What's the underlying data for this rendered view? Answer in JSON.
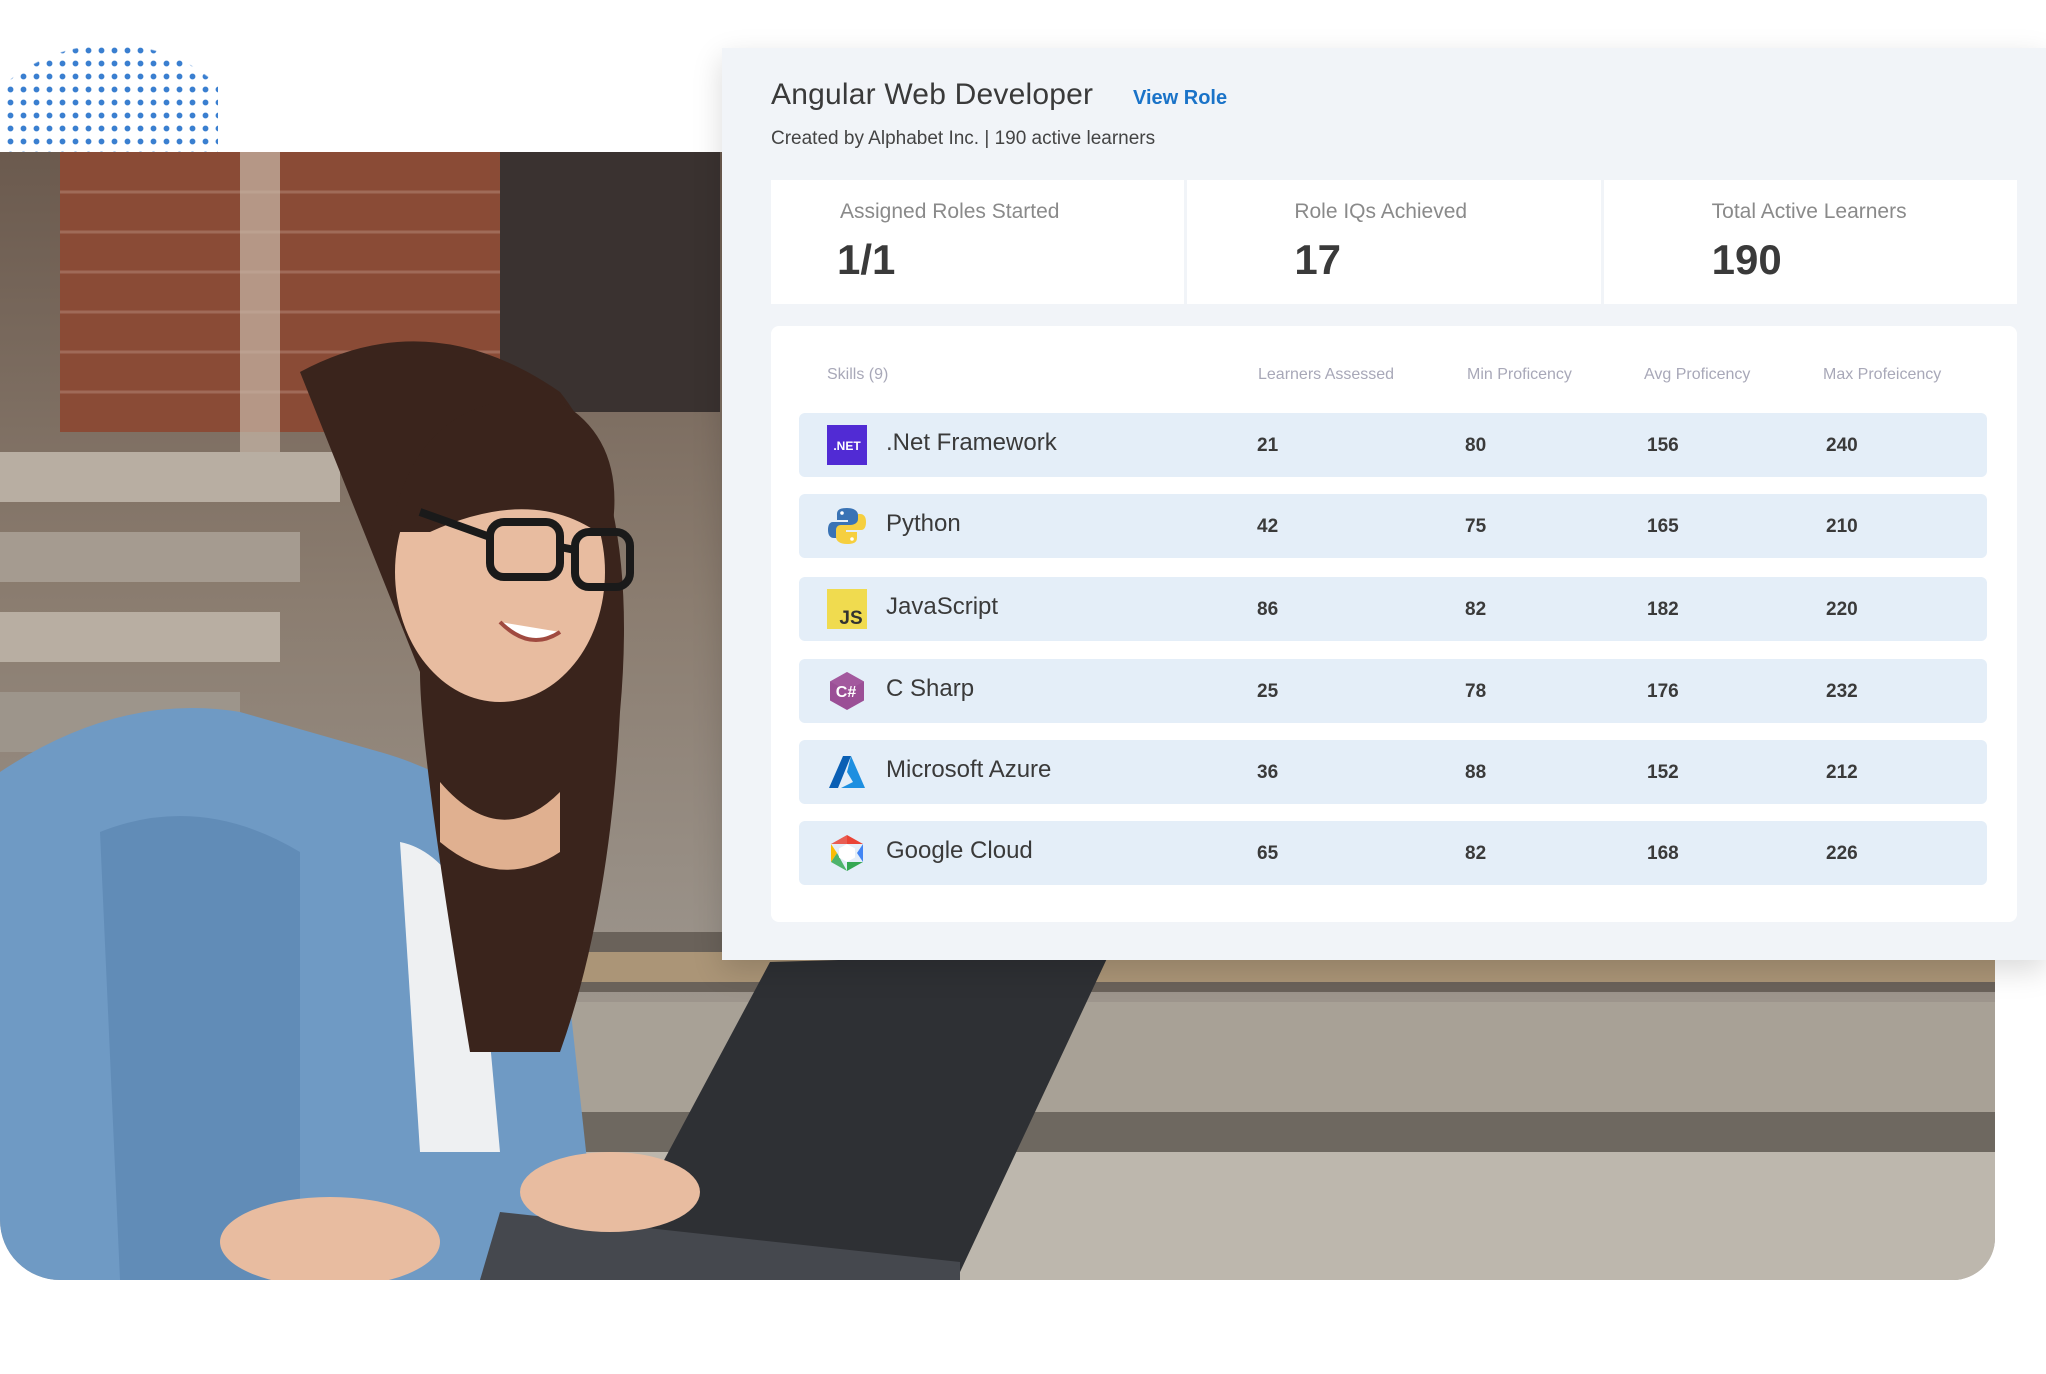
{
  "role": {
    "title": "Angular Web Developer",
    "view_link": "View Role",
    "subtitle": "Created by Alphabet Inc. | 190 active learners"
  },
  "stats": [
    {
      "label": "Assigned Roles Started",
      "value": "1/1"
    },
    {
      "label": "Role IQs Achieved",
      "value": "17"
    },
    {
      "label": "Total Active Learners",
      "value": "190"
    }
  ],
  "table": {
    "headers": {
      "skills": "Skills (9)",
      "learners": "Learners Assessed",
      "min": "Min Proficency",
      "avg": "Avg Proficency",
      "max": "Max Profeicency"
    },
    "rows": [
      {
        "name": ".Net Framework",
        "icon": "dotnet-icon",
        "icon_text": ".NET",
        "learners": "21",
        "min": "80",
        "avg": "156",
        "max": "240"
      },
      {
        "name": "Python",
        "icon": "python-icon",
        "learners": "42",
        "min": "75",
        "avg": "165",
        "max": "210"
      },
      {
        "name": "JavaScript",
        "icon": "javascript-icon",
        "icon_text": "JS",
        "learners": "86",
        "min": "82",
        "avg": "182",
        "max": "220"
      },
      {
        "name": "C Sharp",
        "icon": "csharp-icon",
        "icon_text": "C#",
        "learners": "25",
        "min": "78",
        "avg": "176",
        "max": "232"
      },
      {
        "name": "Microsoft Azure",
        "icon": "azure-icon",
        "learners": "36",
        "min": "88",
        "avg": "152",
        "max": "212"
      },
      {
        "name": "Google Cloud",
        "icon": "google-cloud-icon",
        "learners": "65",
        "min": "82",
        "avg": "168",
        "max": "226"
      }
    ]
  },
  "colors": {
    "accent_link": "#1a73c8",
    "row_bg": "#e4eef8",
    "panel_bg": "#f1f4f8",
    "dots": "#3a7fd0"
  }
}
